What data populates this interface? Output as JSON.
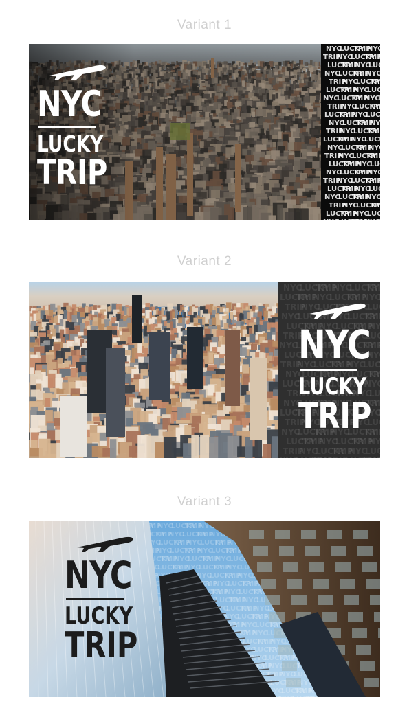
{
  "variants": [
    {
      "title": "Variant 1"
    },
    {
      "title": "Variant 2"
    },
    {
      "title": "Variant 3"
    }
  ],
  "logo": {
    "line1": "NYC",
    "line2": "LUCKY",
    "line3": "TRIP",
    "icon": "airplane-icon"
  },
  "pattern_words": [
    "NYC",
    "LUCKY",
    "TRIP"
  ],
  "colors": {
    "dark_panel": "#2f2f2f",
    "sky": "#8fc3ea",
    "logo_dark": "#1c1c1c",
    "caption": "#cfcfcf"
  }
}
